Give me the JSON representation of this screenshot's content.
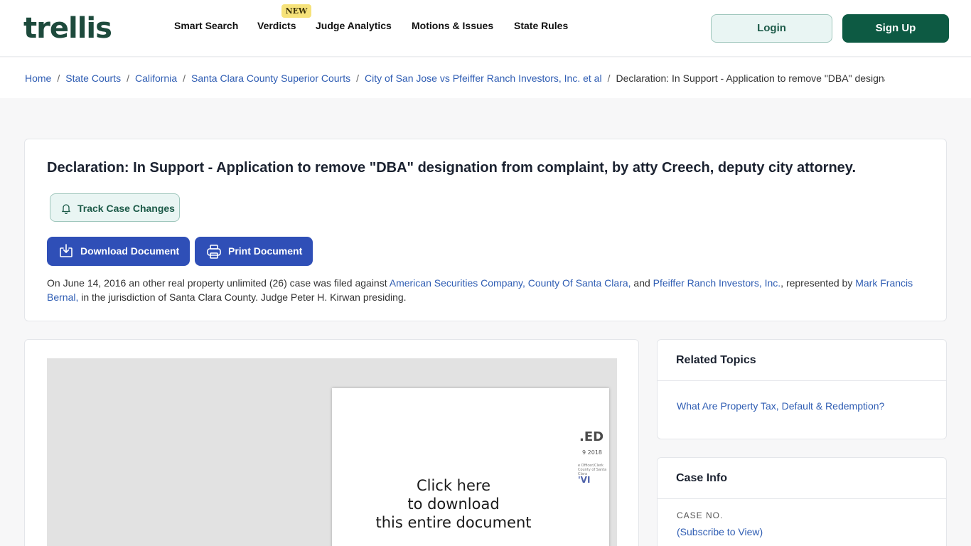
{
  "header": {
    "logo_text": "trellis",
    "nav": [
      {
        "label": "Smart Search"
      },
      {
        "label": "Verdicts"
      },
      {
        "label": "Judge Analytics"
      },
      {
        "label": "Motions & Issues"
      },
      {
        "label": "State Rules"
      }
    ],
    "new_badge": "NEW",
    "login_label": "Login",
    "signup_label": "Sign Up"
  },
  "breadcrumb": {
    "items": [
      "Home",
      "State Courts",
      "California",
      "Santa Clara County Superior Courts",
      "City of San Jose vs Pfeiffer Ranch Investors, Inc. et al"
    ],
    "current": "Declaration: In Support - Application to remove \"DBA\" designati..."
  },
  "summary": {
    "title": "Declaration: In Support - Application to remove \"DBA\" designation from complaint, by atty Creech, deputy city attorney.",
    "track_label": "Track Case Changes",
    "download_label": "Download Document",
    "print_label": "Print Document",
    "desc_1": "On June 14, 2016 an other real property unlimited (26) case was filed against ",
    "party_1": "American Securities Company,",
    "party_2": "County Of Santa Clara,",
    "desc_and": " and ",
    "party_3": "Pfeiffer Ranch Investors, Inc.",
    "desc_rep": ", represented by ",
    "attorney": "Mark Francis Bernal,",
    "desc_2": " in the jurisdiction of Santa Clara County. Judge Peter H. Kirwan presiding."
  },
  "preview": {
    "line1": "Click here",
    "line2": "to download",
    "line3": "this entire document",
    "stamp_text": ".ED",
    "stamp_date": "9 2018",
    "stamp_small": "e Officer/Clerk County of Santa Clara",
    "stamp_sig": "'VI"
  },
  "related": {
    "heading": "Related Topics",
    "link": "What Are Property Tax, Default & Redemption?"
  },
  "case_info": {
    "heading": "Case Info",
    "case_no_label": "CASE NO.",
    "case_no_value": "(Subscribe to View)"
  },
  "colors": {
    "brand_green": "#0d5a43",
    "action_blue": "#2f4fb7",
    "link_blue": "#2f5db3"
  },
  "icons": [
    "bell-icon",
    "download-icon",
    "printer-icon"
  ]
}
